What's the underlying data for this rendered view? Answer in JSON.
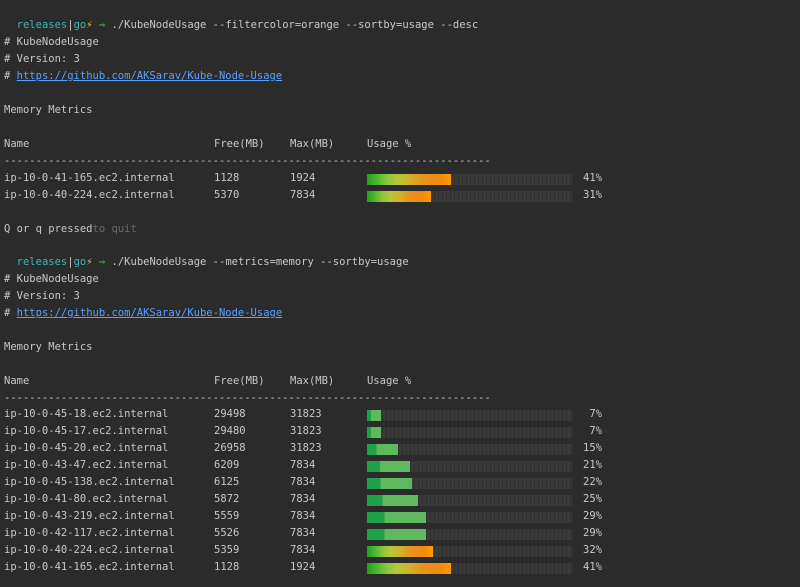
{
  "session1": {
    "prompt": {
      "dir": "releases",
      "sep": "|",
      "branch": "go",
      "bolt": "⚡",
      "arrow": "⇒"
    },
    "command": "./KubeNodeUsage --filtercolor=orange --sortby=usage --desc",
    "header": [
      "# KubeNodeUsage",
      "# Version: 3",
      "# "
    ],
    "link": "https://github.com/AKSarav/Kube-Node-Usage",
    "section_title": "Memory Metrics",
    "columns": {
      "name": "Name",
      "free": "Free(MB)",
      "max": "Max(MB)",
      "usage": "Usage %"
    },
    "divider": "-----------------------------------------------------------------------------",
    "rows": [
      {
        "name": "ip-10-0-41-165.ec2.internal",
        "free": "1128",
        "max": "1924",
        "pct": "41%",
        "usage": 0.41
      },
      {
        "name": "ip-10-0-40-224.ec2.internal",
        "free": "5370",
        "max": "7834",
        "pct": "31%",
        "usage": 0.31
      }
    ],
    "quit_msg": "Q or q pressed",
    "quit_hint": "to quit"
  },
  "session2": {
    "prompt": {
      "dir": "releases",
      "sep": "|",
      "branch": "go",
      "bolt": "⚡",
      "arrow": "⇒"
    },
    "command": "./KubeNodeUsage --metrics=memory --sortby=usage",
    "header": [
      "# KubeNodeUsage",
      "# Version: 3",
      "# "
    ],
    "link": "https://github.com/AKSarav/Kube-Node-Usage",
    "section_title": "Memory Metrics",
    "columns": {
      "name": "Name",
      "free": "Free(MB)",
      "max": "Max(MB)",
      "usage": "Usage %"
    },
    "divider": "-----------------------------------------------------------------------------",
    "rows": [
      {
        "name": "ip-10-0-45-18.ec2.internal",
        "free": "29498",
        "max": "31823",
        "pct": "7%",
        "usage": 0.07
      },
      {
        "name": "ip-10-0-45-17.ec2.internal",
        "free": "29480",
        "max": "31823",
        "pct": "7%",
        "usage": 0.07
      },
      {
        "name": "ip-10-0-45-20.ec2.internal",
        "free": "26958",
        "max": "31823",
        "pct": "15%",
        "usage": 0.15
      },
      {
        "name": "ip-10-0-43-47.ec2.internal",
        "free": "6209",
        "max": "7834",
        "pct": "21%",
        "usage": 0.21
      },
      {
        "name": "ip-10-0-45-138.ec2.internal",
        "free": "6125",
        "max": "7834",
        "pct": "22%",
        "usage": 0.22
      },
      {
        "name": "ip-10-0-41-80.ec2.internal",
        "free": "5872",
        "max": "7834",
        "pct": "25%",
        "usage": 0.25
      },
      {
        "name": "ip-10-0-43-219.ec2.internal",
        "free": "5559",
        "max": "7834",
        "pct": "29%",
        "usage": 0.29
      },
      {
        "name": "ip-10-0-42-117.ec2.internal",
        "free": "5526",
        "max": "7834",
        "pct": "29%",
        "usage": 0.29
      },
      {
        "name": "ip-10-0-40-224.ec2.internal",
        "free": "5359",
        "max": "7834",
        "pct": "32%",
        "usage": 0.32
      },
      {
        "name": "ip-10-0-41-165.ec2.internal",
        "free": "1128",
        "max": "1924",
        "pct": "41%",
        "usage": 0.41
      }
    ]
  }
}
